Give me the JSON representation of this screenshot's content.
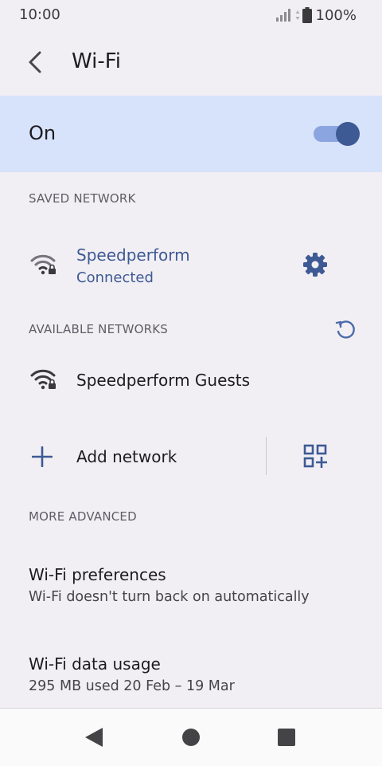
{
  "status_bar": {
    "time": "10:00",
    "battery": "100%"
  },
  "app_bar": {
    "title": "Wi-Fi"
  },
  "master_switch": {
    "label": "On",
    "enabled": true
  },
  "saved_section": {
    "header": "SAVED NETWORK",
    "network": {
      "name": "Speedperform",
      "status": "Connected"
    }
  },
  "available_section": {
    "header": "AVAILABLE NETWORKS",
    "networks": [
      {
        "name": "Speedperform Guests"
      }
    ]
  },
  "add_network": {
    "label": "Add network"
  },
  "advanced_section": {
    "header": "MORE ADVANCED",
    "items": [
      {
        "title": "Wi-Fi preferences",
        "summary": "Wi-Fi doesn't turn back on automatically"
      },
      {
        "title": "Wi-Fi data usage",
        "summary": "295 MB used 20 Feb – 19 Mar"
      }
    ]
  },
  "colors": {
    "accent": "#3e5a94",
    "switch_bar": "#d7e2fb",
    "background": "#f1eff4"
  },
  "icons": [
    "signal-icon",
    "battery-icon",
    "back-arrow-icon",
    "wifi-lock-icon",
    "gear-icon",
    "refresh-icon",
    "plus-icon",
    "qr-code-icon",
    "nav-back-icon",
    "nav-home-icon",
    "nav-recents-icon"
  ]
}
